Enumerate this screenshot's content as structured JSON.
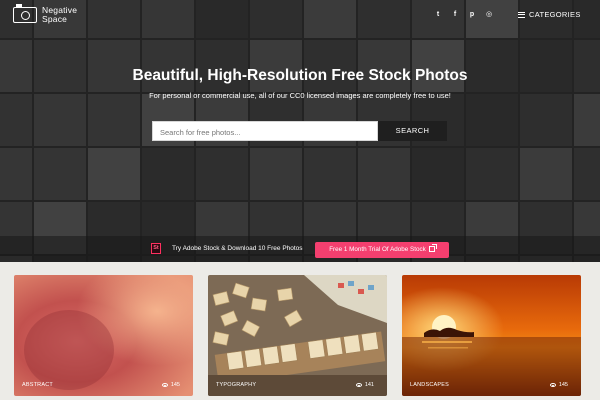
{
  "brand": {
    "name": "Negative\nSpace"
  },
  "social_links": [
    {
      "icon": "twitter-icon",
      "glyph": "t"
    },
    {
      "icon": "facebook-icon",
      "glyph": "f"
    },
    {
      "icon": "pinterest-icon",
      "glyph": "p"
    },
    {
      "icon": "instagram-icon",
      "glyph": "◎"
    }
  ],
  "nav": {
    "categories_label": "CATEGORIES"
  },
  "hero": {
    "title": "Beautiful, High-Resolution Free Stock Photos",
    "subtitle": "For personal or commercial use, all of our CC0 licensed images are completely free to use!"
  },
  "search": {
    "placeholder": "Search for free photos...",
    "button_label": "SEARCH"
  },
  "promo": {
    "icon_text": "St",
    "text": "Try Adobe Stock & Download 10 Free Photos",
    "button_label": "Free 1 Month Trial Of Adobe Stock"
  },
  "categories": [
    {
      "label": "ABSTRACT",
      "views": "145"
    },
    {
      "label": "TYPOGRAPHY",
      "views": "141"
    },
    {
      "label": "LANDSCAPES",
      "views": "145"
    }
  ],
  "colors": {
    "accent": "#f43f6f",
    "hero_dark": "#2c2c2c",
    "page_bg": "#ecebe7"
  }
}
